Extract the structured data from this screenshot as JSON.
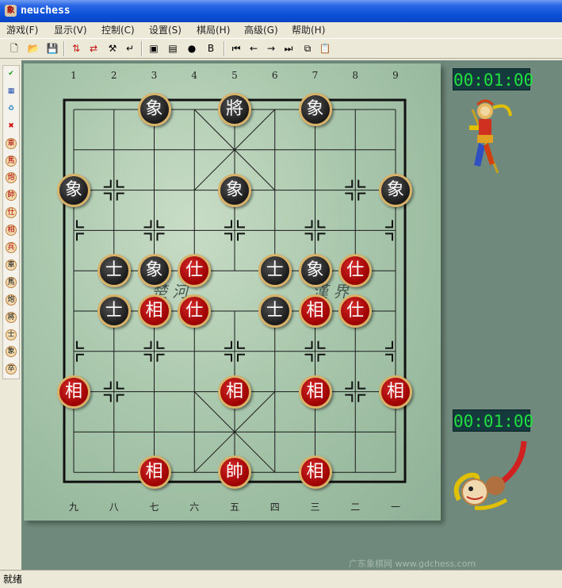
{
  "window": {
    "title": "neuchess",
    "app_icon_glyph": "象"
  },
  "menu": [
    "游戏(F)",
    "显示(V)",
    "控制(C)",
    "设置(S)",
    "棋局(H)",
    "高级(G)",
    "帮助(H)"
  ],
  "toolbar": [
    {
      "icon": "new-file-icon",
      "glyph": "🗋"
    },
    {
      "icon": "open-folder-icon",
      "glyph": "📂"
    },
    {
      "icon": "save-icon",
      "glyph": "💾"
    },
    {
      "icon": "flip-board-icon",
      "glyph": "⇅"
    },
    {
      "icon": "swap-sides-icon",
      "glyph": "⇄"
    },
    {
      "icon": "hint-icon",
      "glyph": "⚒"
    },
    {
      "icon": "undo-move-icon",
      "glyph": "↵"
    },
    {
      "icon": "computer-icon",
      "glyph": "▣"
    },
    {
      "icon": "monitor-icon",
      "glyph": "▤"
    },
    {
      "icon": "sphere-icon",
      "glyph": "●"
    },
    {
      "icon": "bold-b-icon",
      "glyph": "B"
    },
    {
      "icon": "first-move-icon",
      "glyph": "⏮"
    },
    {
      "icon": "prev-move-icon",
      "glyph": "←"
    },
    {
      "icon": "next-move-icon",
      "glyph": "→"
    },
    {
      "icon": "last-move-icon",
      "glyph": "⏭"
    },
    {
      "icon": "copy-icon",
      "glyph": "⧉"
    },
    {
      "icon": "paste-icon",
      "glyph": "📋"
    }
  ],
  "sidebar": [
    {
      "icon": "confirm-icon",
      "glyph": "✔",
      "color": "#1a9a1a"
    },
    {
      "icon": "setup-icon",
      "glyph": "▦",
      "color": "#2050b0"
    },
    {
      "icon": "recycle-icon",
      "glyph": "♻",
      "color": "#2080c0"
    },
    {
      "icon": "delete-icon",
      "glyph": "✖",
      "color": "#d01010"
    },
    {
      "icon": "piece-icon",
      "glyph": "車",
      "color": "#b00000"
    },
    {
      "icon": "piece-icon",
      "glyph": "馬",
      "color": "#b00000"
    },
    {
      "icon": "piece-icon",
      "glyph": "炮",
      "color": "#b00000"
    },
    {
      "icon": "piece-icon",
      "glyph": "帥",
      "color": "#b00000"
    },
    {
      "icon": "piece-icon",
      "glyph": "仕",
      "color": "#b00000"
    },
    {
      "icon": "piece-icon",
      "glyph": "相",
      "color": "#b00000"
    },
    {
      "icon": "piece-icon",
      "glyph": "兵",
      "color": "#b00000"
    },
    {
      "icon": "piece-icon",
      "glyph": "車",
      "color": "#111111"
    },
    {
      "icon": "piece-icon",
      "glyph": "馬",
      "color": "#111111"
    },
    {
      "icon": "piece-icon",
      "glyph": "炮",
      "color": "#111111"
    },
    {
      "icon": "piece-icon",
      "glyph": "將",
      "color": "#111111"
    },
    {
      "icon": "piece-icon",
      "glyph": "士",
      "color": "#111111"
    },
    {
      "icon": "piece-icon",
      "glyph": "象",
      "color": "#111111"
    },
    {
      "icon": "piece-icon",
      "glyph": "卒",
      "color": "#111111"
    }
  ],
  "board": {
    "top_files": [
      "1",
      "2",
      "3",
      "4",
      "5",
      "6",
      "7",
      "8",
      "9"
    ],
    "bottom_files": [
      "九",
      "八",
      "七",
      "六",
      "五",
      "四",
      "三",
      "二",
      "一"
    ],
    "river_left": "楚 河",
    "river_right": "漢 界"
  },
  "pieces": [
    {
      "side": "black",
      "label": "象",
      "col": 2,
      "row": 0
    },
    {
      "side": "black",
      "label": "將",
      "col": 4,
      "row": 0
    },
    {
      "side": "black",
      "label": "象",
      "col": 6,
      "row": 0
    },
    {
      "side": "black",
      "label": "象",
      "col": 0,
      "row": 2
    },
    {
      "side": "black",
      "label": "象",
      "col": 4,
      "row": 2
    },
    {
      "side": "black",
      "label": "象",
      "col": 8,
      "row": 2
    },
    {
      "side": "black",
      "label": "士",
      "col": 1,
      "row": 4
    },
    {
      "side": "black",
      "label": "象",
      "col": 2,
      "row": 4
    },
    {
      "side": "red",
      "label": "仕",
      "col": 3,
      "row": 4
    },
    {
      "side": "black",
      "label": "士",
      "col": 5,
      "row": 4
    },
    {
      "side": "black",
      "label": "象",
      "col": 6,
      "row": 4
    },
    {
      "side": "red",
      "label": "仕",
      "col": 7,
      "row": 4
    },
    {
      "side": "black",
      "label": "士",
      "col": 1,
      "row": 5
    },
    {
      "side": "red",
      "label": "相",
      "col": 2,
      "row": 5
    },
    {
      "side": "red",
      "label": "仕",
      "col": 3,
      "row": 5
    },
    {
      "side": "black",
      "label": "士",
      "col": 5,
      "row": 5
    },
    {
      "side": "red",
      "label": "相",
      "col": 6,
      "row": 5
    },
    {
      "side": "red",
      "label": "仕",
      "col": 7,
      "row": 5
    },
    {
      "side": "red",
      "label": "相",
      "col": 0,
      "row": 7
    },
    {
      "side": "red",
      "label": "相",
      "col": 4,
      "row": 7
    },
    {
      "side": "red",
      "label": "相",
      "col": 6,
      "row": 7
    },
    {
      "side": "red",
      "label": "相",
      "col": 8,
      "row": 7
    },
    {
      "side": "red",
      "label": "相",
      "col": 2,
      "row": 9
    },
    {
      "side": "red",
      "label": "帥",
      "col": 4,
      "row": 9
    },
    {
      "side": "red",
      "label": "相",
      "col": 6,
      "row": 9
    }
  ],
  "clocks": {
    "top": "00:01:00",
    "bottom": "00:01:00"
  },
  "status": "就绪",
  "watermark": "广东象棋网 www.gdchess.com"
}
